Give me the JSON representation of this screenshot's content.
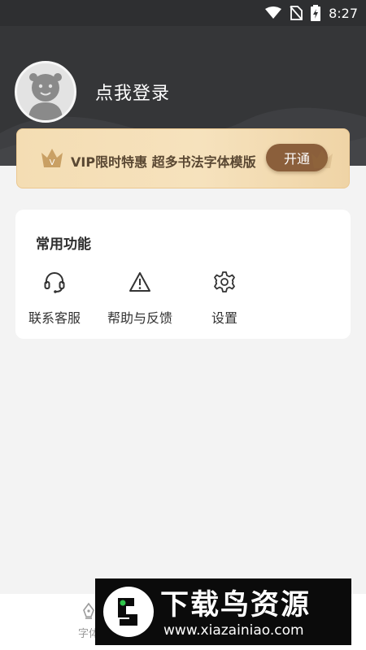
{
  "status_bar": {
    "time": "8:27",
    "icons": [
      "wifi-icon",
      "no-sim-icon",
      "battery-charging-icon"
    ]
  },
  "profile": {
    "login_prompt": "点我登录",
    "avatar_icon": "default-avatar-icon"
  },
  "vip_banner": {
    "text": "VIP限时特惠 超多书法字体模版",
    "button_label": "开通",
    "crown_badge": "V",
    "accent_color": "#8b5f3b"
  },
  "common_functions": {
    "title": "常用功能",
    "items": [
      {
        "label": "联系客服",
        "icon": "headset-icon"
      },
      {
        "label": "帮助与反馈",
        "icon": "warning-triangle-icon"
      },
      {
        "label": "设置",
        "icon": "gear-icon"
      }
    ]
  },
  "bottom_nav": {
    "items": [
      {
        "label": "字体",
        "icon": "pen-nib-icon"
      }
    ]
  },
  "watermark": {
    "title": "下载鸟资源",
    "url": "www.xiazainiao.com"
  }
}
